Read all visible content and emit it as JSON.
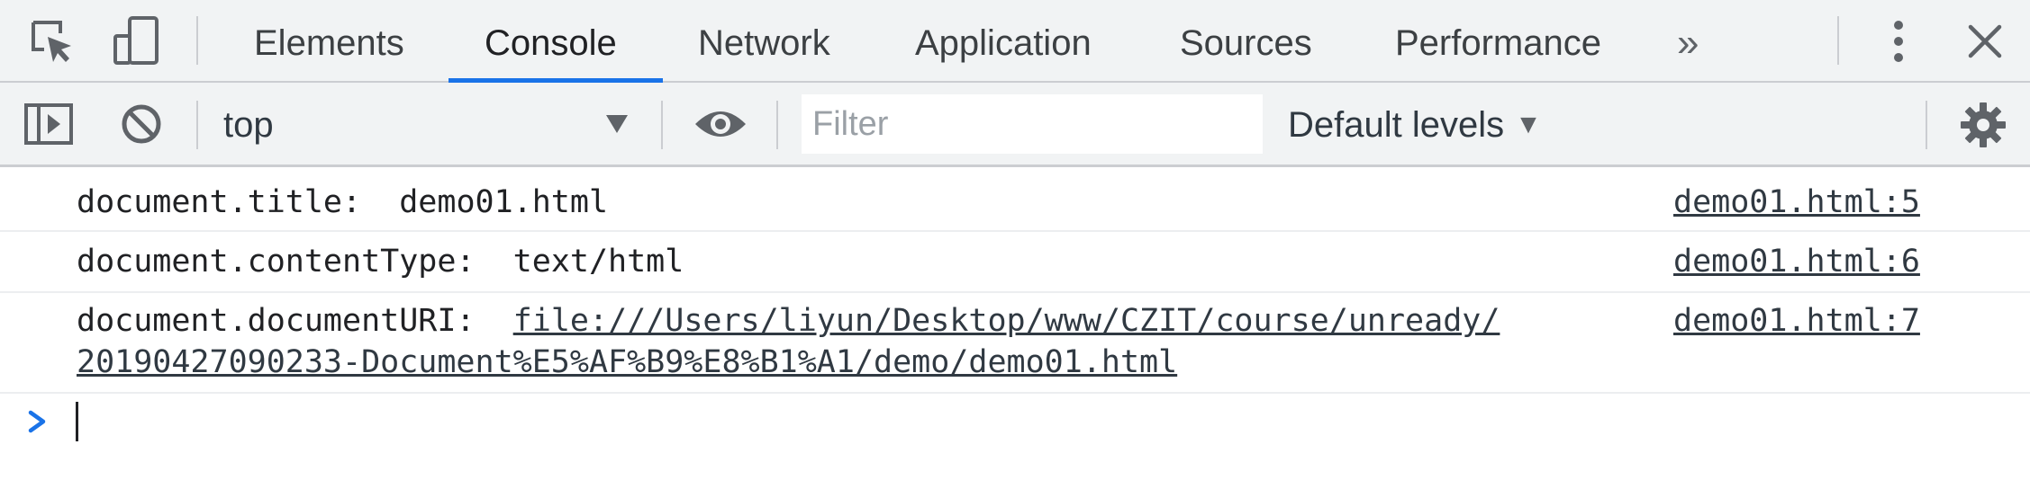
{
  "tabs": {
    "items": [
      {
        "label": "Elements"
      },
      {
        "label": "Console"
      },
      {
        "label": "Network"
      },
      {
        "label": "Application"
      },
      {
        "label": "Sources"
      },
      {
        "label": "Performance"
      }
    ],
    "active": "Console",
    "more_label": "»"
  },
  "console_toolbar": {
    "context": "top",
    "filter_placeholder": "Filter",
    "filter_value": "",
    "levels_label": "Default levels",
    "levels_caret": "▼"
  },
  "logs": [
    {
      "key": "document.title:",
      "value": "demo01.html",
      "source": "demo01.html:5"
    },
    {
      "key": "document.contentType:",
      "value": "text/html",
      "source": "demo01.html:6"
    },
    {
      "key": "document.documentURI:",
      "link_line1": "file:///Users/liyun/Desktop/www/CZIT/course/unready/",
      "link_line2": "20190427090233-Document%E5%AF%B9%E8%B1%A1/demo/demo01.html",
      "source": "demo01.html:7"
    }
  ],
  "colors": {
    "accent": "#1a73e8",
    "toolbar_bg": "#f1f3f4",
    "icon": "#5f6368"
  }
}
